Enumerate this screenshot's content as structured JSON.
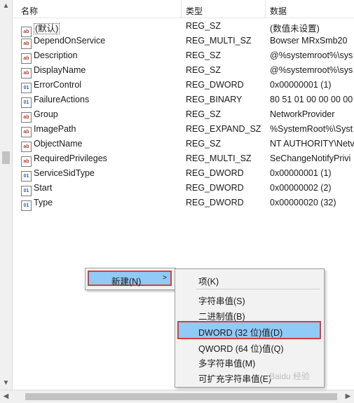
{
  "columns": {
    "name": "名称",
    "type": "类型",
    "data": "数据"
  },
  "rows": [
    {
      "icon": "ab",
      "name": "(默认)",
      "type": "REG_SZ",
      "data": "(数值未设置)"
    },
    {
      "icon": "ab",
      "name": "DependOnService",
      "type": "REG_MULTI_SZ",
      "data": "Bowser MRxSmb20"
    },
    {
      "icon": "ab",
      "name": "Description",
      "type": "REG_SZ",
      "data": "@%systemroot%\\sys"
    },
    {
      "icon": "ab",
      "name": "DisplayName",
      "type": "REG_SZ",
      "data": "@%systemroot%\\sys"
    },
    {
      "icon": "bin",
      "name": "ErrorControl",
      "type": "REG_DWORD",
      "data": "0x00000001 (1)"
    },
    {
      "icon": "bin",
      "name": "FailureActions",
      "type": "REG_BINARY",
      "data": "80 51 01 00 00 00 00"
    },
    {
      "icon": "ab",
      "name": "Group",
      "type": "REG_SZ",
      "data": "NetworkProvider"
    },
    {
      "icon": "ab",
      "name": "ImagePath",
      "type": "REG_EXPAND_SZ",
      "data": "%SystemRoot%\\Syst"
    },
    {
      "icon": "ab",
      "name": "ObjectName",
      "type": "REG_SZ",
      "data": "NT AUTHORITY\\Netv"
    },
    {
      "icon": "ab",
      "name": "RequiredPrivileges",
      "type": "REG_MULTI_SZ",
      "data": "SeChangeNotifyPrivi"
    },
    {
      "icon": "bin",
      "name": "ServiceSidType",
      "type": "REG_DWORD",
      "data": "0x00000001 (1)"
    },
    {
      "icon": "bin",
      "name": "Start",
      "type": "REG_DWORD",
      "data": "0x00000002 (2)"
    },
    {
      "icon": "bin",
      "name": "Type",
      "type": "REG_DWORD",
      "data": "0x00000020 (32)"
    }
  ],
  "context_menu": {
    "new_label": "新建(N)"
  },
  "submenu": {
    "key": "项(K)",
    "string": "字符串值(S)",
    "binary": "二进制值(B)",
    "dword": "DWORD (32 位)值(D)",
    "qword": "QWORD (64 位)值(Q)",
    "multi_string": "多字符串值(M)",
    "expand_string": "可扩充字符串值(E)"
  },
  "icons": {
    "string_value": "ab-string-icon",
    "binary_value": "binary-value-icon"
  },
  "colors": {
    "highlight": "#91c9f7",
    "annotation_border": "#e3393c"
  },
  "watermark": "Baidu 经验"
}
